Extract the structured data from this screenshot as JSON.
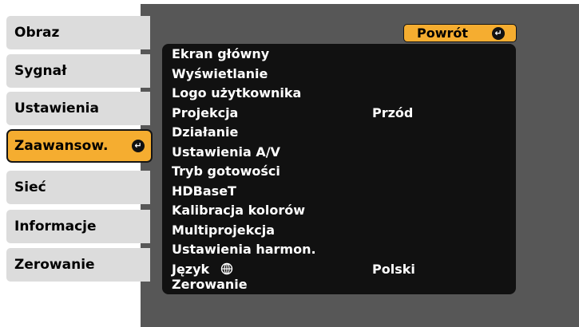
{
  "sidebar": {
    "items": [
      {
        "label": "Obraz"
      },
      {
        "label": "Sygnał"
      },
      {
        "label": "Ustawienia"
      },
      {
        "label": "Zaawansow."
      },
      {
        "label": "Sieć"
      },
      {
        "label": "Informacje"
      },
      {
        "label": "Zerowanie"
      }
    ],
    "active_index": 3,
    "active_icon": "enter-icon"
  },
  "header": {
    "back_label": "Powrót",
    "back_icon": "enter-icon"
  },
  "menu": {
    "items": [
      {
        "label": "Ekran główny",
        "value": ""
      },
      {
        "label": "Wyświetlanie",
        "value": ""
      },
      {
        "label": "Logo użytkownika",
        "value": ""
      },
      {
        "label": "Projekcja",
        "value": "Przód"
      },
      {
        "label": "Działanie",
        "value": ""
      },
      {
        "label": "Ustawienia A/V",
        "value": ""
      },
      {
        "label": "Tryb gotowości",
        "value": ""
      },
      {
        "label": "HDBaseT",
        "value": ""
      },
      {
        "label": "Kalibracja kolorów",
        "value": ""
      },
      {
        "label": "Multiprojekcja",
        "value": ""
      },
      {
        "label": "Ustawienia harmon.",
        "value": ""
      },
      {
        "label": "Język",
        "value": "Polski",
        "icon": "globe-icon"
      },
      {
        "label": "Zerowanie",
        "value": ""
      }
    ]
  },
  "colors": {
    "accent": "#f5ad30",
    "tab_bg": "#dcdcdc",
    "panel_bg": "#575757",
    "list_bg": "#111111"
  }
}
